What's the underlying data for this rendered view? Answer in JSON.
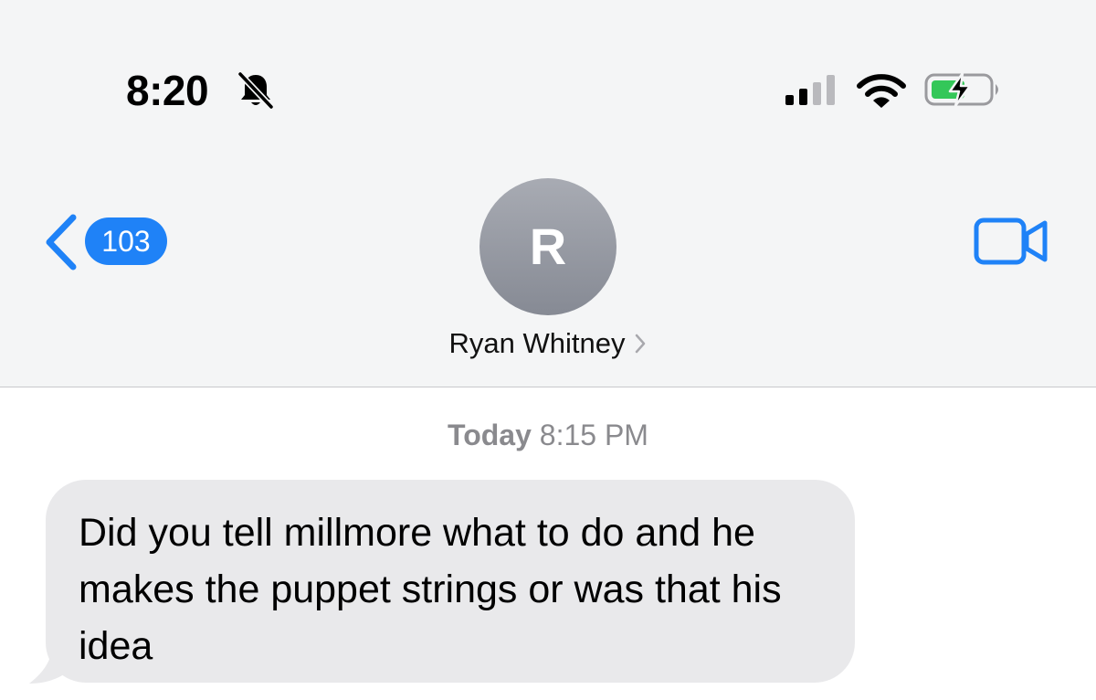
{
  "status_bar": {
    "time": "8:20",
    "icons": [
      "bell-slash-icon",
      "cellular-signal-icon",
      "wifi-icon",
      "battery-charging-icon"
    ]
  },
  "nav": {
    "back_icon": "chevron-left-icon",
    "unread_count": "103",
    "avatar_initial": "R",
    "contact_name": "Ryan Whitney",
    "contact_chevron_icon": "chevron-right-icon",
    "video_icon": "facetime-video-icon"
  },
  "conversation": {
    "timestamp_day": "Today",
    "timestamp_time": "8:15 PM",
    "messages": [
      {
        "direction": "incoming",
        "text": "Did you tell millmore what to do and he makes the puppet strings or was that his idea"
      }
    ]
  },
  "colors": {
    "accent": "#1f82f7",
    "bubble_incoming": "#e9e9eb",
    "battery_charge": "#34c759"
  }
}
